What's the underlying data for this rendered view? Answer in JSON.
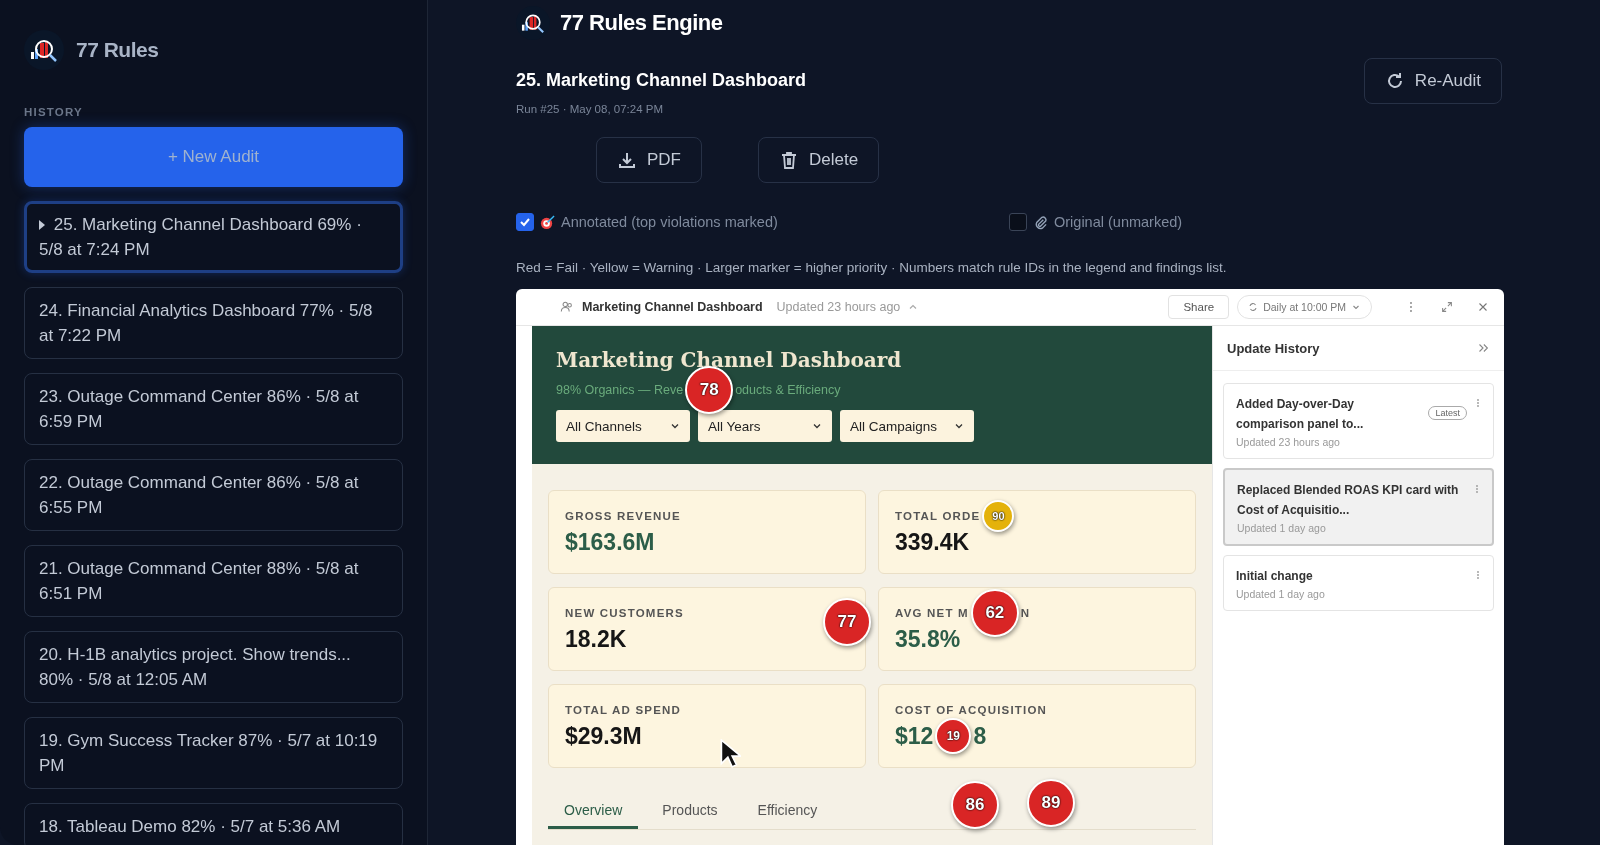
{
  "sidebar": {
    "brand": "77 Rules",
    "section_label": "HISTORY",
    "new_button": "+ New Audit",
    "items": [
      {
        "text": "25. Marketing Channel Dashboard 69% · 5/8 at 7:24 PM",
        "selected": true
      },
      {
        "text": "24. Financial Analytics Dashboard 77% · 5/8 at 7:22 PM",
        "selected": false
      },
      {
        "text": "23. Outage Command Center 86% · 5/8 at 6:59 PM",
        "selected": false
      },
      {
        "text": "22. Outage Command Center 86% · 5/8 at 6:55 PM",
        "selected": false
      },
      {
        "text": "21. Outage Command Center 88% · 5/8 at 6:51 PM",
        "selected": false
      },
      {
        "text": "20. H-1B analytics project. Show trends... 80% · 5/8 at 12:05 AM",
        "selected": false
      },
      {
        "text": "19. Gym Success Tracker 87% · 5/7 at 10:19 PM",
        "selected": false
      },
      {
        "text": "18. Tableau Demo 82% · 5/7 at 5:36 AM",
        "selected": false
      }
    ]
  },
  "app_title": "77 Rules Engine",
  "audit": {
    "title": "25. Marketing Channel Dashboard",
    "meta": "Run #25 · May 08, 07:24 PM",
    "reaudit_button": "Re-Audit",
    "pdf_button": "PDF",
    "delete_button": "Delete"
  },
  "view_options": [
    {
      "kind": "target",
      "label": "Annotated (top violations marked)",
      "checked": true
    },
    {
      "kind": "paperclip",
      "label": "Original (unmarked)",
      "checked": false
    }
  ],
  "legend": "Red = Fail · Yellow = Warning · Larger marker = higher priority · Numbers match rule IDs in the legend and findings list.",
  "screenshot": {
    "topbar": {
      "title": "Marketing Channel Dashboard",
      "updated": "Updated 23 hours ago",
      "share_button": "Share",
      "schedule": "Daily at 10:00 PM"
    },
    "header": {
      "title": "Marketing Channel Dashboard",
      "subtitle": [
        {
          "kind": "text",
          "text": "98% Organics — Reve"
        },
        {
          "kind": "marker",
          "number": "78",
          "color": "#d92525",
          "large": true
        },
        {
          "kind": "text",
          "text": "oducts & Efficiency"
        }
      ],
      "filters": [
        "All Channels",
        "All Years",
        "All Campaigns"
      ]
    },
    "kpis": [
      {
        "label": [
          {
            "kind": "text",
            "text": "GROSS REVENUE"
          }
        ],
        "value": [
          {
            "kind": "text",
            "text": "$163.6M"
          }
        ],
        "color": "#2c5d48"
      },
      {
        "label": [
          {
            "kind": "text",
            "text": "TOTAL ORDE"
          },
          {
            "kind": "marker",
            "number": "90",
            "color": "#e4b20b",
            "large": false
          }
        ],
        "value": [
          {
            "kind": "text",
            "text": "339.4K"
          }
        ],
        "color": "#161616"
      },
      {
        "label": [
          {
            "kind": "text",
            "text": "NEW CUSTOMERS"
          }
        ],
        "value": [
          {
            "kind": "text",
            "text": "18.2K"
          }
        ],
        "color": "#161616",
        "edge_marker": {
          "number": "77",
          "color": "#d92525",
          "large": true
        }
      },
      {
        "label": [
          {
            "kind": "text",
            "text": "AVG NET M"
          },
          {
            "kind": "marker",
            "number": "62",
            "color": "#d92525",
            "large": true
          },
          {
            "kind": "text",
            "text": "N"
          }
        ],
        "value": [
          {
            "kind": "text",
            "text": "35.8%"
          }
        ],
        "color": "#2c5d48"
      },
      {
        "label": [
          {
            "kind": "text",
            "text": "TOTAL AD SPEND"
          }
        ],
        "value": [
          {
            "kind": "text",
            "text": "$29.3M"
          }
        ],
        "color": "#161616"
      },
      {
        "label": [
          {
            "kind": "text",
            "text": "COST OF ACQUISITION"
          }
        ],
        "value": [
          {
            "kind": "text",
            "text": "$12"
          },
          {
            "kind": "marker",
            "number": "19",
            "color": "#d92525",
            "large": false
          },
          {
            "kind": "text",
            "text": "8"
          }
        ],
        "color": "#2c5d48",
        "below_markers": [
          {
            "number": "86",
            "color": "#d92525",
            "large": true
          },
          {
            "number": "89",
            "color": "#d92525",
            "large": true
          }
        ]
      }
    ],
    "tabs": [
      {
        "label": "Overview",
        "selected": true
      },
      {
        "label": "Products",
        "selected": false
      },
      {
        "label": "Efficiency",
        "selected": false
      }
    ],
    "history": {
      "title": "Update History",
      "entries": [
        {
          "title": "Added Day-over-Day comparison panel to...",
          "time": "Updated 23 hours ago",
          "badge": "Latest",
          "selected": false
        },
        {
          "title": "Replaced Blended ROAS KPI card with Cost of Acquisitio...",
          "time": "Updated 1 day ago",
          "selected": true
        },
        {
          "title": "Initial change",
          "time": "Updated 1 day ago",
          "selected": false
        }
      ]
    }
  }
}
